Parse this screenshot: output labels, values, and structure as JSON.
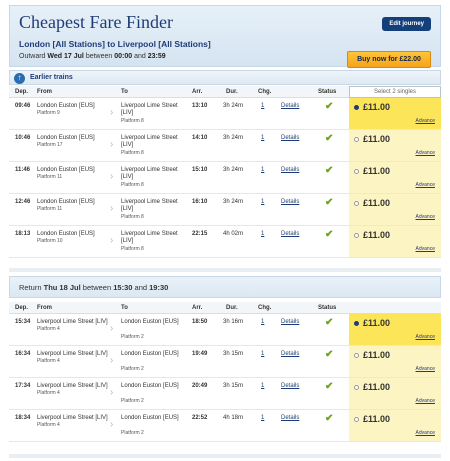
{
  "header": {
    "title": "Cheapest Fare Finder",
    "route": "London [All Stations] to Liverpool [All Stations]",
    "outward_prefix": "Outward",
    "outward_date": "Wed 17 Jul",
    "between": "between",
    "outward_from": "00:00",
    "and": "and",
    "outward_to": "23:59",
    "edit_button": "Edit journey",
    "buy_button": "Buy now for £22.00"
  },
  "earlier": {
    "icon": "up-arrow-icon",
    "label": "Earlier trains"
  },
  "columns": {
    "dep": "Dep.",
    "from": "From",
    "to": "To",
    "arr": "Arr.",
    "dur": "Dur.",
    "chg": "Chg.",
    "status": "Status",
    "select_singles": "Select 2 singles"
  },
  "outward_rows": [
    {
      "dep": "09:46",
      "from": "London Euston [EUS]",
      "from_platform": "Platform 9",
      "to": "Liverpool Lime Street [LIV]",
      "to_platform": "Platform 8",
      "arr": "13:10",
      "dur": "3h 24m",
      "chg": "1",
      "details": "Details",
      "status": "✔",
      "price": "£11.00",
      "fare": "Advance"
    },
    {
      "dep": "10:46",
      "from": "London Euston [EUS]",
      "from_platform": "Platform 17",
      "to": "Liverpool Lime Street [LIV]",
      "to_platform": "Platform 8",
      "arr": "14:10",
      "dur": "3h 24m",
      "chg": "1",
      "details": "Details",
      "status": "✔",
      "price": "£11.00",
      "fare": "Advance"
    },
    {
      "dep": "11:46",
      "from": "London Euston [EUS]",
      "from_platform": "Platform 11",
      "to": "Liverpool Lime Street [LIV]",
      "to_platform": "Platform 8",
      "arr": "15:10",
      "dur": "3h 24m",
      "chg": "1",
      "details": "Details",
      "status": "✔",
      "price": "£11.00",
      "fare": "Advance"
    },
    {
      "dep": "12:46",
      "from": "London Euston [EUS]",
      "from_platform": "Platform 11",
      "to": "Liverpool Lime Street [LIV]",
      "to_platform": "Platform 8",
      "arr": "16:10",
      "dur": "3h 24m",
      "chg": "1",
      "details": "Details",
      "status": "✔",
      "price": "£11.00",
      "fare": "Advance"
    },
    {
      "dep": "18:13",
      "from": "London Euston [EUS]",
      "from_platform": "Platform 10",
      "to": "Liverpool Lime Street [LIV]",
      "to_platform": "Platform 8",
      "arr": "22:15",
      "dur": "4h 02m",
      "chg": "1",
      "details": "Details",
      "status": "✔",
      "price": "£11.00",
      "fare": "Advance"
    }
  ],
  "return": {
    "prefix": "Return",
    "date": "Thu 18 Jul",
    "between": "between",
    "from": "15:30",
    "and": "and",
    "to": "19:30"
  },
  "return_rows": [
    {
      "dep": "15:34",
      "from": "Liverpool Lime Street [LIV]",
      "from_platform": "Platform 4",
      "to": "London Euston [EUS]",
      "to_platform": "Platform 2",
      "arr": "18:50",
      "dur": "3h 16m",
      "chg": "1",
      "details": "Details",
      "status": "✔",
      "price": "£11.00",
      "fare": "Advance"
    },
    {
      "dep": "16:34",
      "from": "Liverpool Lime Street [LIV]",
      "from_platform": "Platform 4",
      "to": "London Euston [EUS]",
      "to_platform": "Platform 2",
      "arr": "19:49",
      "dur": "3h 15m",
      "chg": "1",
      "details": "Details",
      "status": "✔",
      "price": "£11.00",
      "fare": "Advance"
    },
    {
      "dep": "17:34",
      "from": "Liverpool Lime Street [LIV]",
      "from_platform": "Platform 4",
      "to": "London Euston [EUS]",
      "to_platform": "Platform 2",
      "arr": "20:49",
      "dur": "3h 15m",
      "chg": "1",
      "details": "Details",
      "status": "✔",
      "price": "£11.00",
      "fare": "Advance"
    },
    {
      "dep": "18:34",
      "from": "Liverpool Lime Street [LIV]",
      "from_platform": "Platform 4",
      "to": "London Euston [EUS]",
      "to_platform": "Platform 2",
      "arr": "22:52",
      "dur": "4h 18m",
      "chg": "1",
      "details": "Details",
      "status": "✔",
      "price": "£11.00",
      "fare": "Advance"
    }
  ],
  "colors": {
    "brand_blue": "#1e3c78",
    "buy_orange": "#f6a31a",
    "selected_fare": "#fde55a",
    "fare_cell": "#fdf4c4",
    "status_green": "#6ca31a"
  }
}
